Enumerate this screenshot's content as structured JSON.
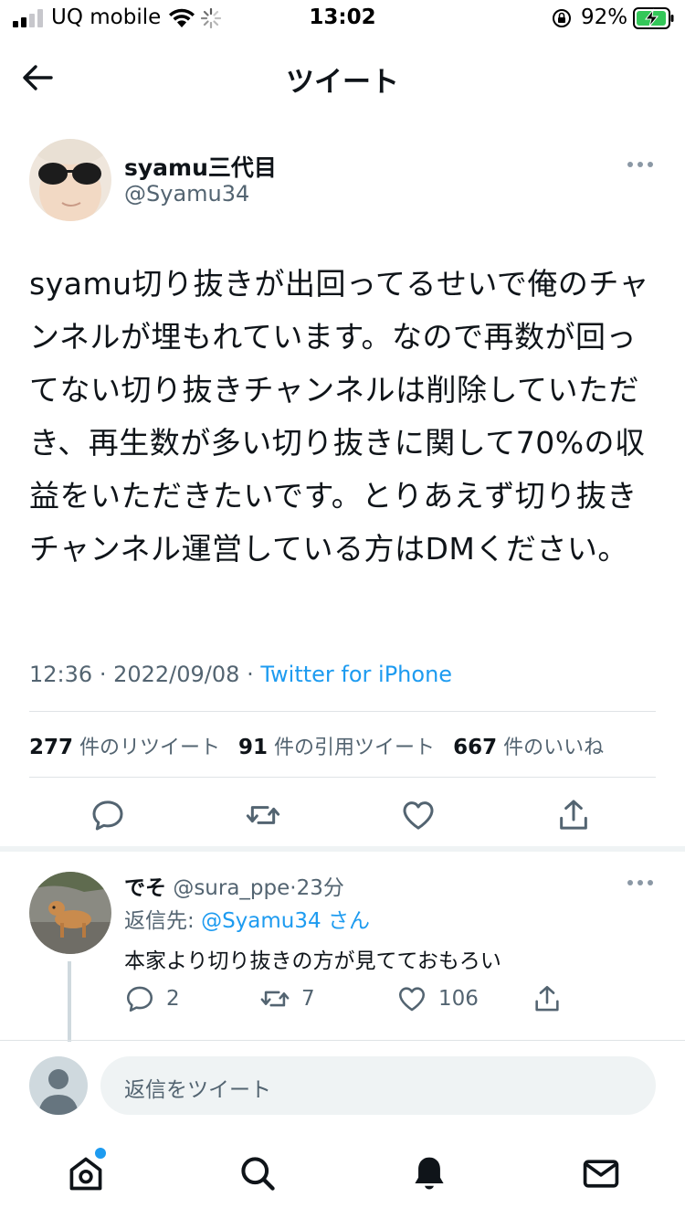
{
  "status_bar": {
    "carrier": "UQ mobile",
    "time": "13:02",
    "battery": "92%"
  },
  "header": {
    "title": "ツイート"
  },
  "tweet": {
    "display_name": "syamu三代目",
    "handle": "@Syamu34",
    "text": "syamu切り抜きが出回ってるせいで俺のチャンネルが埋もれています。なので再数が回ってない切り抜きチャンネルは削除していただき、再生数が多い切り抜きに関して70%の収益をいただきたいです。とりあえず切り抜きチャンネル運営している方はDMください。",
    "time": "12:36",
    "date": "2022/09/08",
    "source": "Twitter for iPhone",
    "retweets_count": "277",
    "retweets_label": "件のリツイート",
    "quotes_count": "91",
    "quotes_label": "件の引用ツイート",
    "likes_count": "667",
    "likes_label": "件のいいね"
  },
  "reply": {
    "display_name": "でそ",
    "handle": "@sura_ppe",
    "time": "23分",
    "reply_to_label": "返信先:",
    "reply_to_handle": "@Syamu34",
    "reply_to_suffix": "さん",
    "text": "本家より切り抜きの方が見てておもろい",
    "reply_count": "2",
    "retweet_count": "7",
    "like_count": "106"
  },
  "composer": {
    "placeholder": "返信をツイート"
  },
  "icons": {
    "back": "arrow-left-icon",
    "more": "more-dots-icon",
    "reply": "comment-icon",
    "retweet": "retweet-icon",
    "like": "heart-icon",
    "share": "share-icon",
    "home": "home-icon",
    "search": "search-icon",
    "notifications": "bell-icon",
    "messages": "mail-icon"
  },
  "colors": {
    "accent": "#1d9bf0",
    "text": "#0f1419",
    "secondary": "#536471",
    "divider": "#dfe3e6"
  }
}
